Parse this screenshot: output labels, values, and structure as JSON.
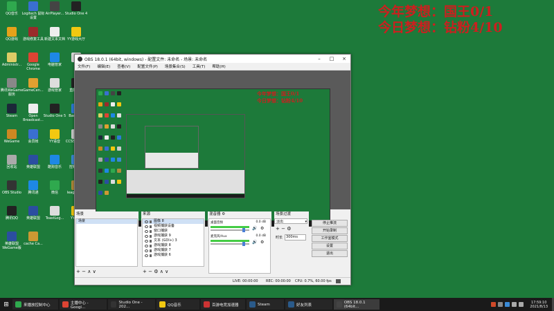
{
  "desktop": {
    "overlay": {
      "line1": "今年梦想：国王0/1",
      "line2": "今日梦想：钻粉4/10"
    },
    "icons": [
      {
        "label": "QQ音乐",
        "color": "#2fa94e"
      },
      {
        "label": "Logitech 鼠标设置",
        "color": "#3a6fd1"
      },
      {
        "label": "AirPlayer...",
        "color": "#444444"
      },
      {
        "label": "Studio One 4",
        "color": "#222222"
      },
      {
        "label": "QQ游戏",
        "color": "#e5a21a"
      },
      {
        "label": "游戏修复工具",
        "color": "#9a2b2b"
      },
      {
        "label": "新建文本文档",
        "color": "#eeeeee"
      },
      {
        "label": "YY游戏大厅",
        "color": "#f2c811"
      },
      {
        "label": "Administr...",
        "color": "#ddcc66"
      },
      {
        "label": "Google Chrome",
        "color": "#dd4433"
      },
      {
        "label": "电脑管家",
        "color": "#1e88e5"
      },
      {
        "label": "",
        "color": "#dddddd"
      },
      {
        "label": "腾讯WeGame 服务",
        "color": "#888888"
      },
      {
        "label": "GameCen...",
        "color": "#e0a030"
      },
      {
        "label": "游戏管家",
        "color": "#dddddd"
      },
      {
        "label": "直播app",
        "color": "#222222"
      },
      {
        "label": "Steam",
        "color": "#1b2838"
      },
      {
        "label": "Open Broadcast...",
        "color": "#eeeeee"
      },
      {
        "label": "Studio One 5",
        "color": "#222222"
      },
      {
        "label": "Bandizip",
        "color": "#2d7bd8"
      },
      {
        "label": "WeGame",
        "color": "#cc8822"
      },
      {
        "label": "会员帐",
        "color": "#3a6fd1"
      },
      {
        "label": "YY语音",
        "color": "#f2c811"
      },
      {
        "label": "CCS51_WI...",
        "color": "#cccccc"
      },
      {
        "label": "回收站",
        "color": "#aaaaaa"
      },
      {
        "label": "英雄联盟",
        "color": "#2b4ea0"
      },
      {
        "label": "酷狗音乐",
        "color": "#1e88e5"
      },
      {
        "label": "控制面板",
        "color": "#3a8ad6"
      },
      {
        "label": "OBS Studio",
        "color": "#333333"
      },
      {
        "label": "腾讯通",
        "color": "#1e88e5"
      },
      {
        "label": "微信",
        "color": "#2fa94e"
      },
      {
        "label": "leagueCl...",
        "color": "#b08a3a"
      },
      {
        "label": "腾讯QQ",
        "color": "#222222"
      },
      {
        "label": "英雄联盟",
        "color": "#2b4ea0"
      },
      {
        "label": "ToastLog...",
        "color": "#dddddd"
      },
      {
        "label": "YY开播",
        "color": "#f2c811"
      },
      {
        "label": "英雄联盟 WeGame版",
        "color": "#2b4ea0"
      },
      {
        "label": "cache Ca...",
        "color": "#cc9933"
      }
    ]
  },
  "obs": {
    "title": "OBS 18.0.1 (64bit, windows) - 配置文件: 未命名 - 场景: 未命名",
    "menu": [
      "文件(F)",
      "编辑(E)",
      "查看(V)",
      "配置文件(P)",
      "场景集合(S)",
      "工具(T)",
      "帮助(H)"
    ],
    "preview_overlay": {
      "line1": "今年梦想：国王0/1",
      "line2": "今日梦想：钻粉4/10"
    },
    "docks": {
      "scenes": {
        "title": "场景",
        "items": [
          "场景"
        ]
      },
      "sources": {
        "title": "来源",
        "items": [
          "图像 8",
          "视频捕获设备",
          "窗口捕获",
          "游戏捕获 9",
          "文本 (GDI+) 3",
          "游戏捕获 8",
          "游戏捕获 7",
          "游戏捕获 6"
        ]
      },
      "mixer": {
        "title": "混音器",
        "tracks": [
          {
            "name": "桌面音频",
            "level": "0.0 dB",
            "volume": 0.85
          },
          {
            "name": "麦克风/Aux",
            "level": "0.0 dB",
            "volume": 0.85
          }
        ]
      },
      "transitions": {
        "title": "场景过渡",
        "selected": "淡出",
        "duration_label": "时长",
        "duration": "300ms"
      }
    },
    "controls": [
      "停止推流",
      "开始录制",
      "工作室模式",
      "设置",
      "退出"
    ],
    "status": {
      "live": "LIVE: 00:00:00",
      "rec": "REC: 00:00:00",
      "cpu": "CPU: 0.7%, 60.00 fps"
    }
  },
  "taskbar": {
    "items": [
      {
        "label": "来播放控制中心",
        "color": "#2fa94e"
      },
      {
        "label": "主播中心 - Googl...",
        "color": "#dd4433"
      },
      {
        "label": "Studio One - 202...",
        "color": "#333333"
      },
      {
        "label": "QQ音乐",
        "color": "#f2c811"
      },
      {
        "label": "百游电竞加速器",
        "color": "#cc3333"
      },
      {
        "label": "Steam",
        "color": "#2a5a8a"
      },
      {
        "label": "好友列表",
        "color": "#2a5a8a"
      },
      {
        "label": "OBS 18.0.1 (64bit...",
        "color": "#444444"
      }
    ],
    "clock": {
      "time": "17:59:10",
      "date": "2021/8/13"
    }
  }
}
